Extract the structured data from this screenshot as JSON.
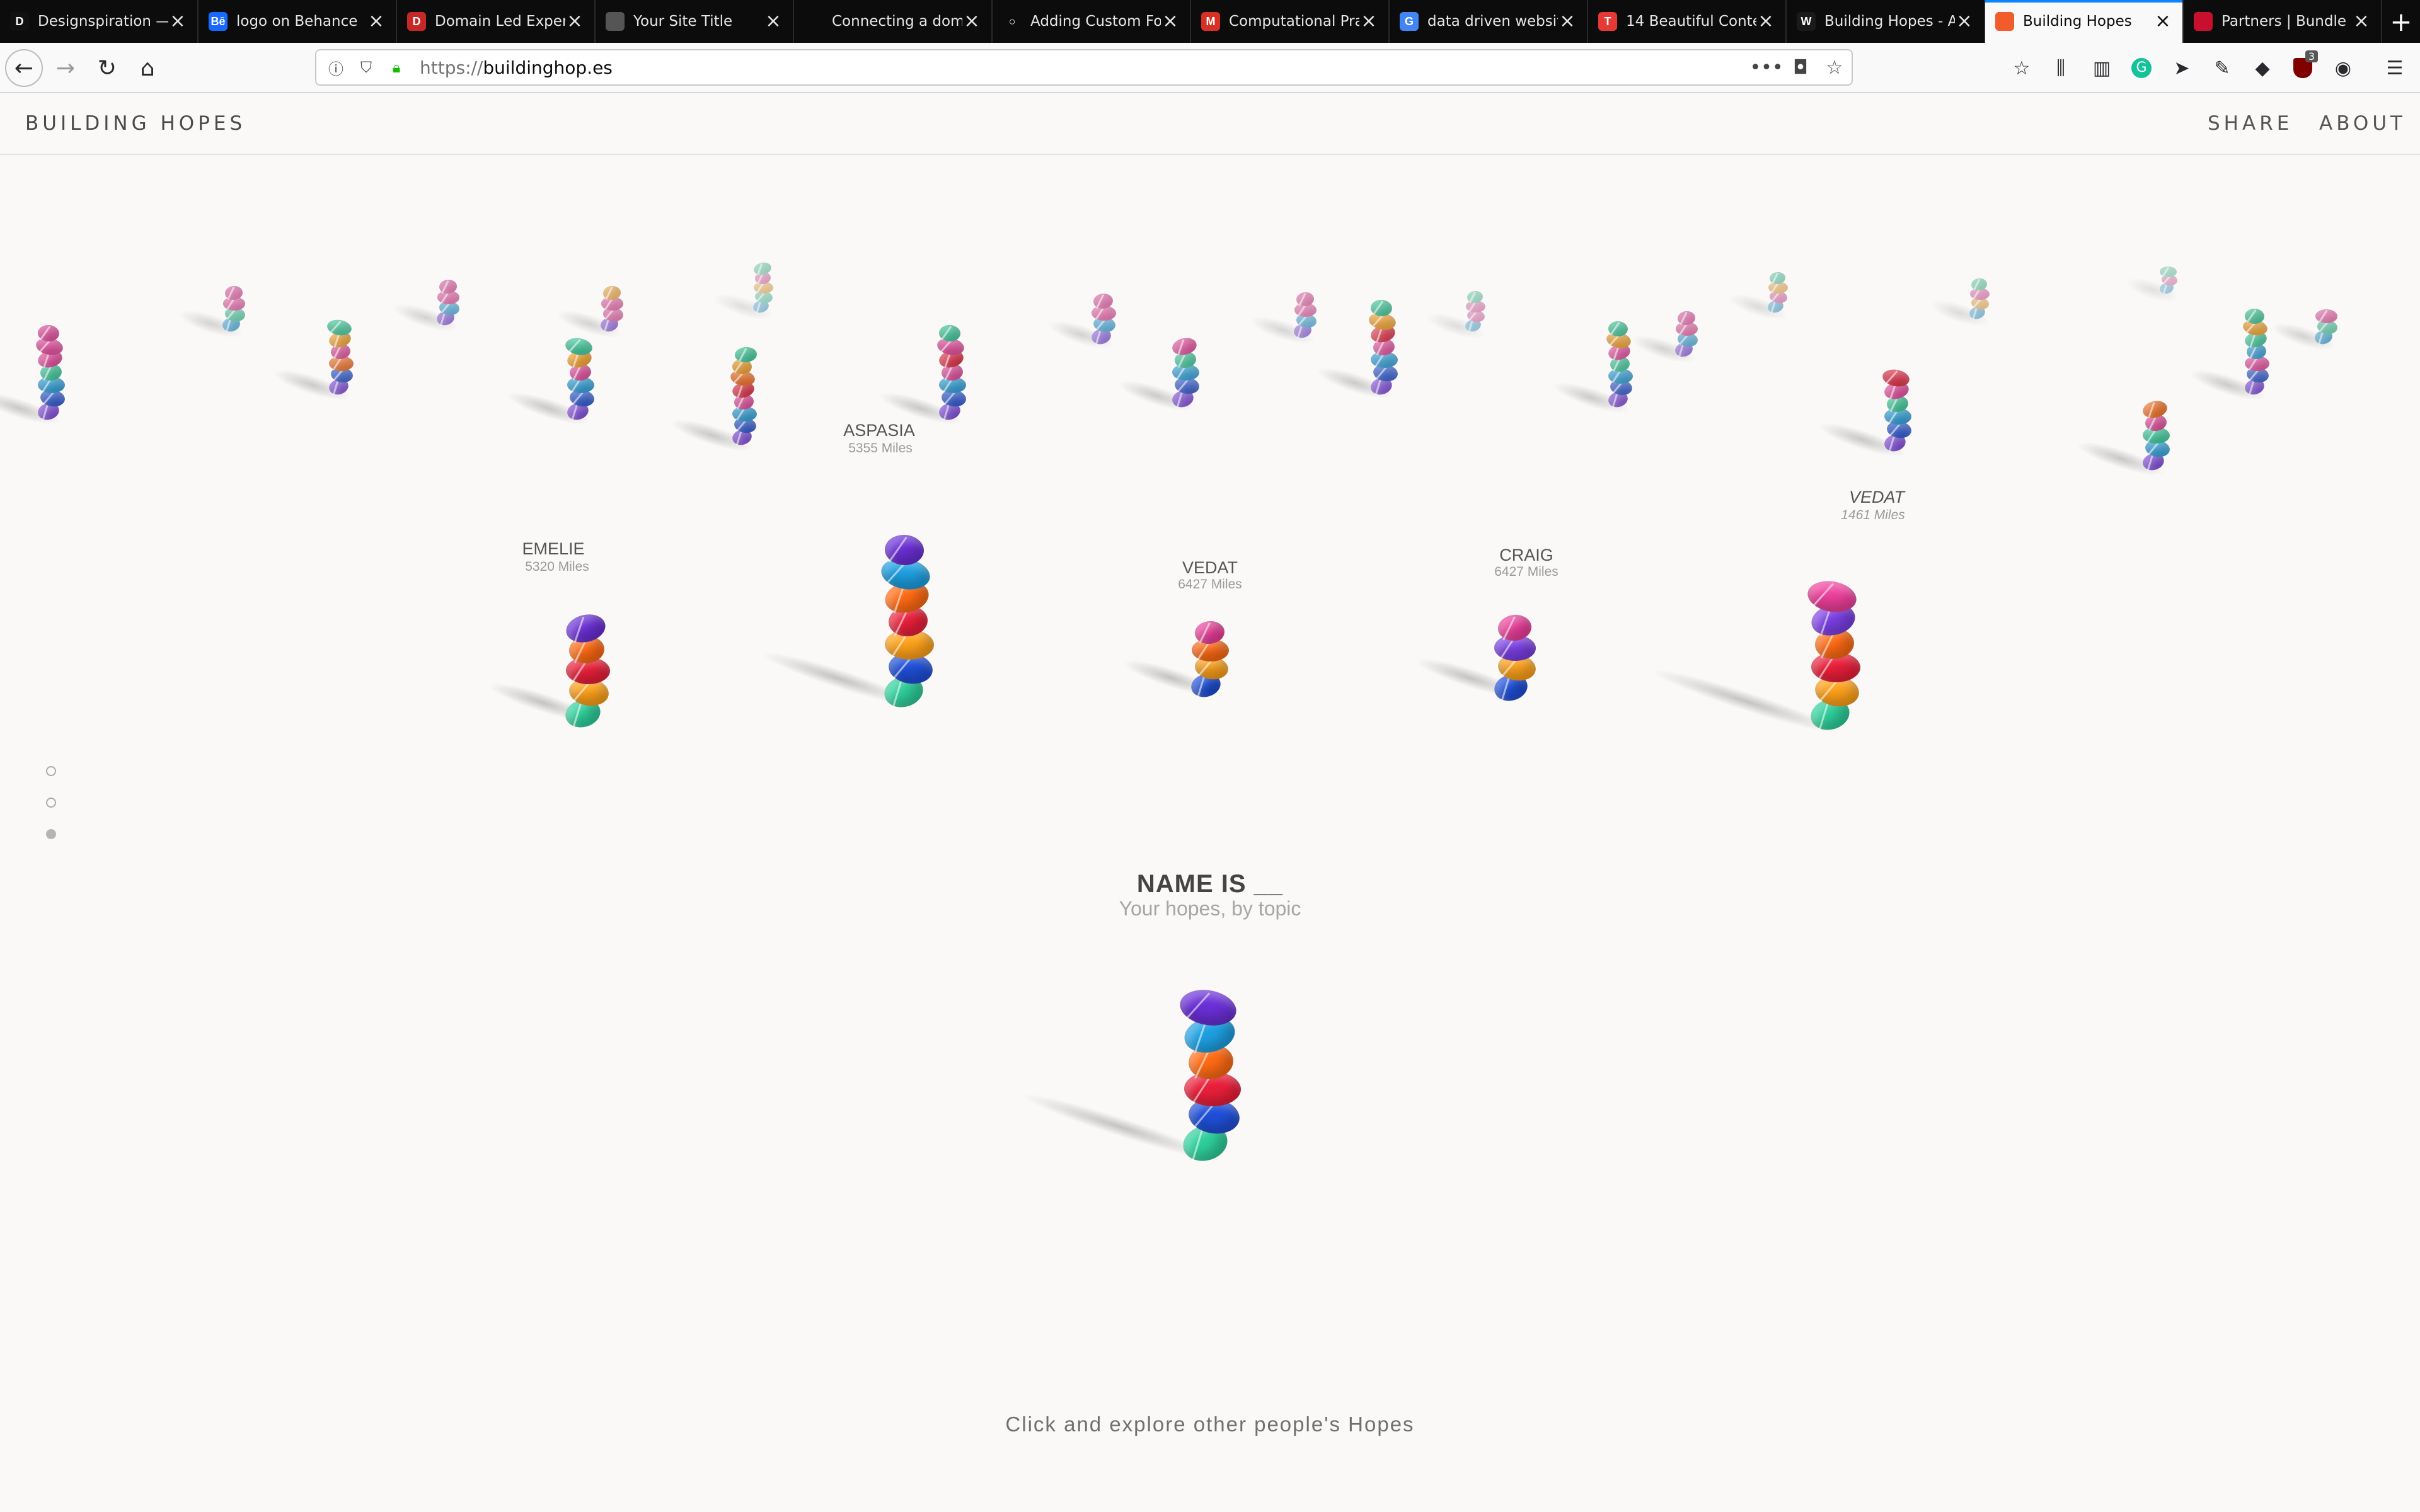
{
  "browser": {
    "tabs": [
      {
        "title": "Designspiration —",
        "favicon_text": "D",
        "favicon_color": "#111111"
      },
      {
        "title": "logo on Behance",
        "favicon_text": "Bē",
        "favicon_color": "#1769ff"
      },
      {
        "title": "Domain Led Exper",
        "favicon_text": "D",
        "favicon_color": "#c62828"
      },
      {
        "title": "Your Site Title",
        "favicon_text": "",
        "favicon_color": "#555555"
      },
      {
        "title": "Connecting a dom",
        "favicon_text": "",
        "favicon_color": "#0c0c0d"
      },
      {
        "title": "Adding Custom Fo",
        "favicon_text": "○",
        "favicon_color": "#0c0c0d"
      },
      {
        "title": "Computational Pra",
        "favicon_text": "M",
        "favicon_color": "#d93025"
      },
      {
        "title": "data driven websit",
        "favicon_text": "G",
        "favicon_color": "#4285f4"
      },
      {
        "title": "14 Beautiful Conte",
        "favicon_text": "T",
        "favicon_color": "#e53935"
      },
      {
        "title": "Building Hopes - A",
        "favicon_text": "W",
        "favicon_color": "#1a1a1a"
      },
      {
        "title": "Building Hopes",
        "favicon_text": "",
        "favicon_color": "#f25c2a",
        "active": true
      },
      {
        "title": "Partners | Bundle",
        "favicon_text": "",
        "favicon_color": "#c8102e"
      }
    ],
    "new_tab": "+",
    "url_protocol": "https://",
    "url_host": "buildinghop.es",
    "badge_count": "3"
  },
  "site": {
    "logo": "BUILDING HOPES",
    "nav_share": "SHARE",
    "nav_about": "ABOUT",
    "focus_title": "NAME IS __",
    "focus_subtitle": "Your hopes, by topic",
    "footer_hint": "Click and explore other people's Hopes"
  },
  "stacks": [
    {
      "name": "EMELIE",
      "miles": "5320 Miles"
    },
    {
      "name": "ASPASIA",
      "miles": "5355 Miles"
    },
    {
      "name": "VEDAT",
      "miles": "6427 Miles"
    },
    {
      "name": "CRAIG",
      "miles": "6427 Miles"
    },
    {
      "name": "VEDAT",
      "miles": "1461 Miles"
    }
  ],
  "colors": {
    "purple": "#6a2fd6",
    "blue": "#1e9fe0",
    "orange": "#ff6a13",
    "red": "#ea1f3a",
    "amber": "#ffa21a",
    "navy": "#1f4fd8",
    "teal": "#2ecf9a",
    "pink": "#ee3f9c",
    "violet": "#7b3fe4"
  }
}
